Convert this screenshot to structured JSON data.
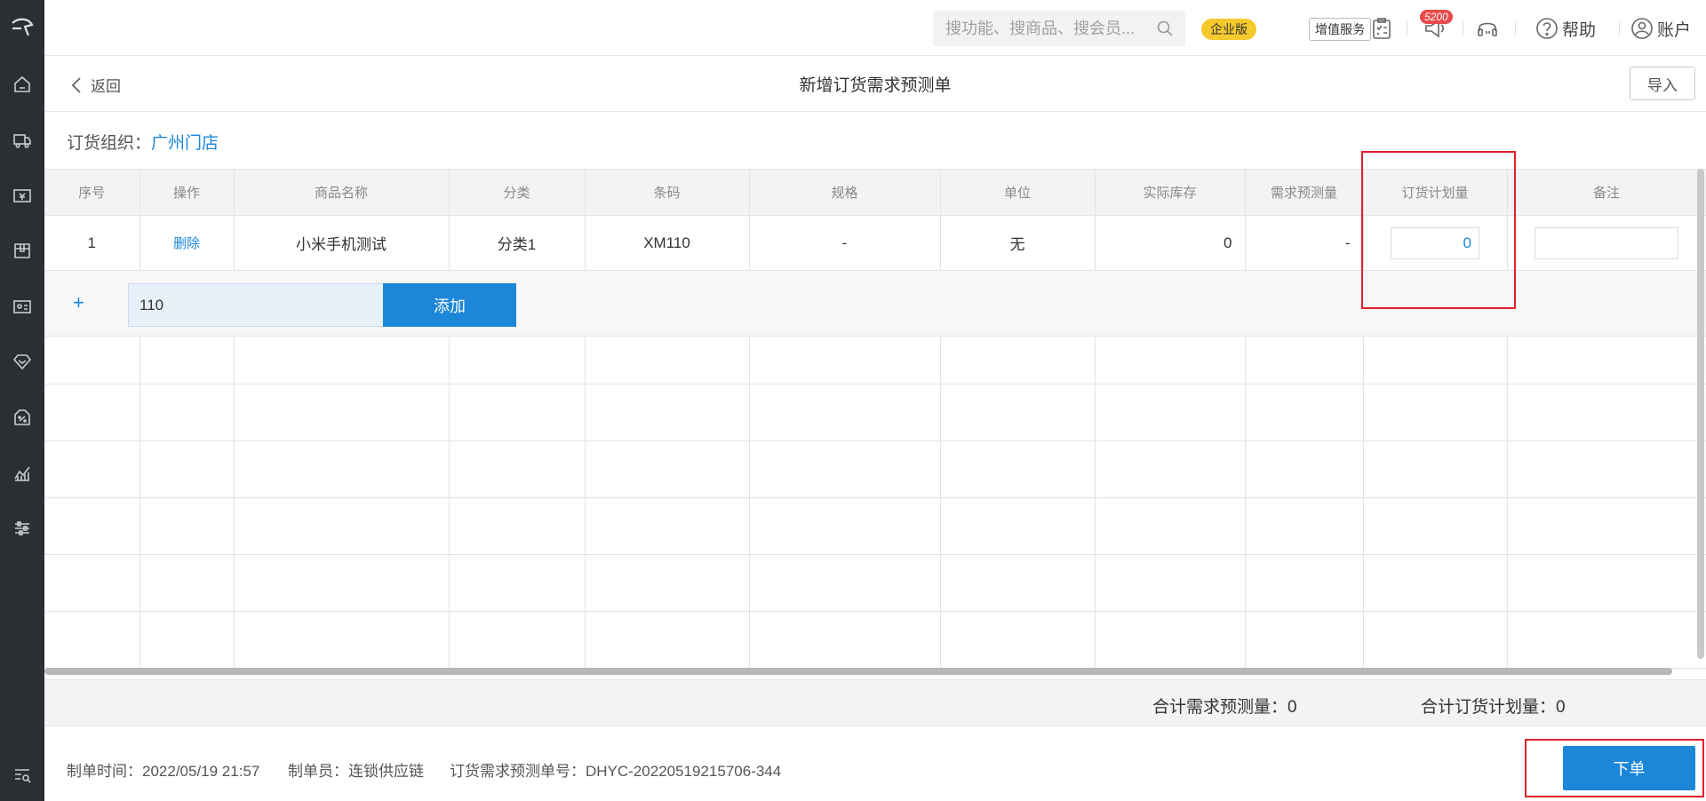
{
  "header": {
    "search_placeholder": "搜功能、搜商品、搜会员...",
    "edition_badge": "企业版",
    "value_added_label": "增值服务",
    "notice_count": "5200",
    "help_label": "帮助",
    "account_label": "账户"
  },
  "titlebar": {
    "back_label": "返回",
    "title": "新增订货需求预测单",
    "import_label": "导入"
  },
  "org": {
    "label": "订货组织：",
    "value": "广州门店"
  },
  "table": {
    "columns": [
      "序号",
      "操作",
      "商品名称",
      "分类",
      "条码",
      "规格",
      "单位",
      "实际库存",
      "需求预测量",
      "订货计划量",
      "备注"
    ],
    "rows": [
      {
        "index": "1",
        "action": "删除",
        "name": "小米手机测试",
        "category": "分类1",
        "barcode": "XM110",
        "spec": "-",
        "unit": "无",
        "stock": "0",
        "forecast": "-",
        "plan_qty": "0",
        "remark": ""
      }
    ],
    "add_row": {
      "plus": "+",
      "input_value": "110",
      "add_label": "添加"
    }
  },
  "totals": {
    "forecast_total": "合计需求预测量：0",
    "plan_total": "合计订货计划量：0"
  },
  "footer": {
    "created_time": "制单时间：2022/05/19 21:57",
    "creator": "制单员：连锁供应链",
    "doc_no": "订货需求预测单号：DHYC-20220519215706-344",
    "submit_label": "下单"
  },
  "colors": {
    "accent": "#1c86d8",
    "sidebar": "#2b2f33",
    "highlight": "#e0202a",
    "badge": "#f6c92c"
  }
}
